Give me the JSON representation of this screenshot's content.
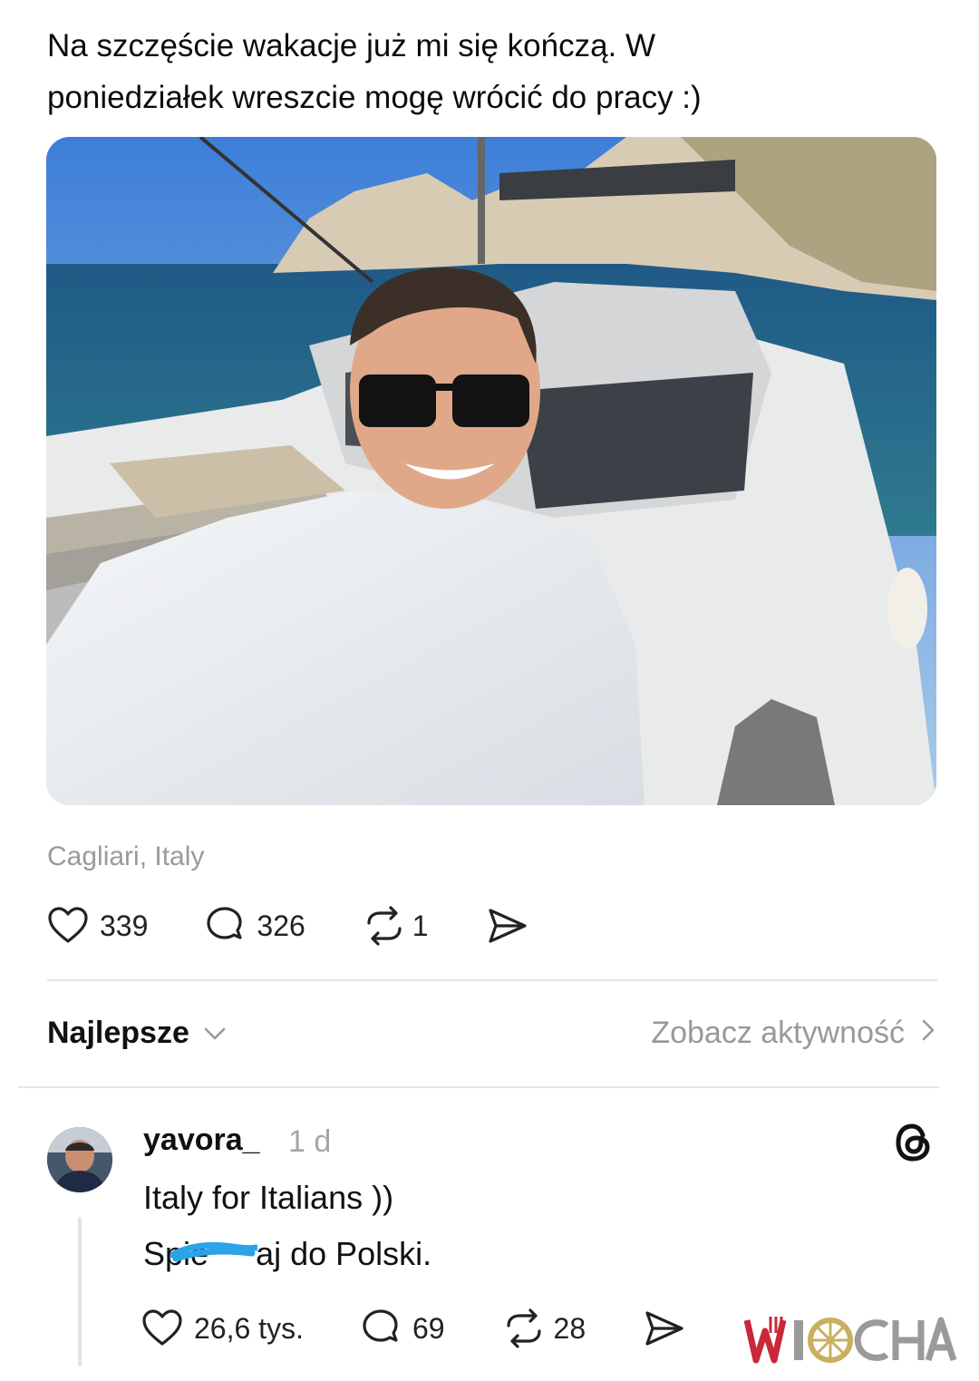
{
  "post": {
    "text_line1": "Na szczęście wakacje już mi się kończą. W",
    "text_line2": "poniedziałek wreszcie mogę wrócić do pracy :)",
    "location": "Cagliari, Italy",
    "likes": "339",
    "replies": "326",
    "reposts": "1"
  },
  "sort_bar": {
    "sort_label": "Najlepsze",
    "activity_label": "Zobacz aktywność"
  },
  "comment": {
    "username": "yavora_",
    "time": "1 d",
    "line1": "Italy for Italians ))",
    "line2_prefix": "Spie",
    "line2_suffix": "aj do Polski.",
    "likes": "26,6 tys.",
    "replies": "69",
    "reposts": "28"
  },
  "watermark": {
    "text": "WIOCHA"
  },
  "icons": {
    "like": "heart-icon",
    "reply": "speech-bubble-icon",
    "repost": "repost-icon",
    "share": "send-icon",
    "threads": "threads-logo-icon"
  },
  "colors": {
    "text": "#111111",
    "muted": "#9a9a9a",
    "divider": "#e6e6e6",
    "redaction": "#2aa3e8",
    "watermark_red": "#c8283a"
  }
}
